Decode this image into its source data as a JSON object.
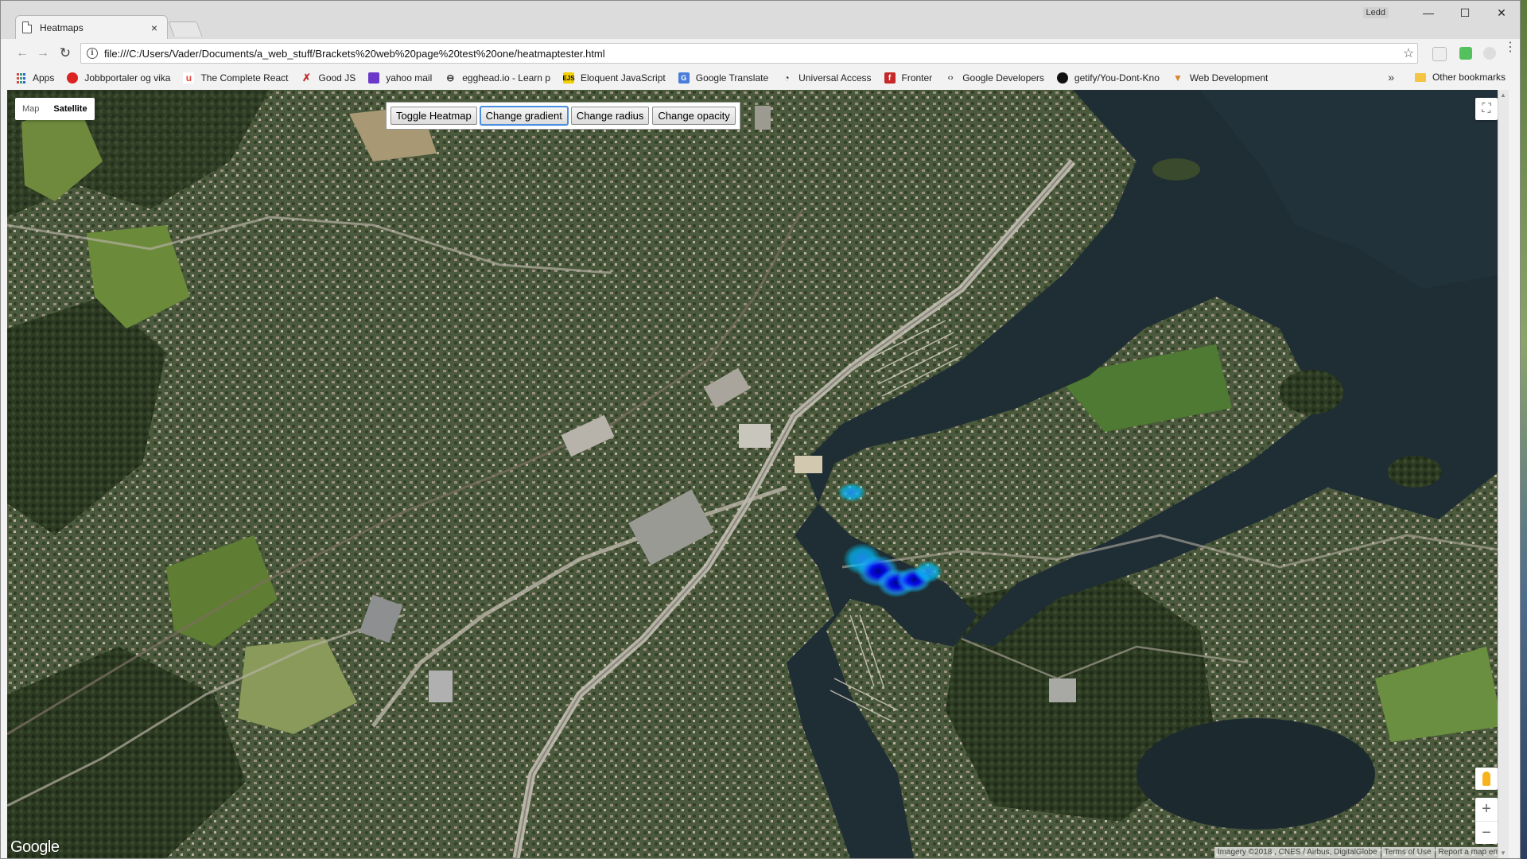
{
  "browser": {
    "tab_title": "Heatmaps",
    "tab_close": "×",
    "profile_name": "Ledd",
    "url": "file:///C:/Users/Vader/Documents/a_web_stuff/Brackets%20web%20page%20test%20one/heatmaptester.html",
    "window_controls": {
      "minimize": "—",
      "maximize": "☐",
      "close": "✕"
    },
    "nav": {
      "back": "←",
      "forward": "→",
      "reload": "↻"
    },
    "star": "☆",
    "menu": "⋮"
  },
  "bookmarks": {
    "items": [
      {
        "label": "Apps",
        "icon": "apps-grid-icon",
        "color": "#d44"
      },
      {
        "label": "Jobbportaler og vika",
        "icon": "jobb-icon",
        "color": "#d22"
      },
      {
        "label": "The Complete React",
        "icon": "udemy-icon",
        "color": "#e0463a"
      },
      {
        "label": "Good JS",
        "icon": "goodjs-icon",
        "color": "#c62828"
      },
      {
        "label": "yahoo mail",
        "icon": "mail-icon",
        "color": "#6b39c9"
      },
      {
        "label": "egghead.io - Learn p",
        "icon": "egghead-icon",
        "color": "#333"
      },
      {
        "label": "Eloquent JavaScript",
        "icon": "ejs-icon",
        "color": "#c9a300"
      },
      {
        "label": "Google Translate",
        "icon": "translate-icon",
        "color": "#4a7ddb"
      },
      {
        "label": "Universal Access",
        "icon": "access-icon",
        "color": "#333"
      },
      {
        "label": "Fronter",
        "icon": "fronter-icon",
        "color": "#c62828"
      },
      {
        "label": "Google Developers",
        "icon": "gdev-icon",
        "color": "#555"
      },
      {
        "label": "getify/You-Dont-Kno",
        "icon": "github-icon",
        "color": "#111"
      },
      {
        "label": "Web Development",
        "icon": "webdev-icon",
        "color": "#d9822b"
      }
    ],
    "overflow": "»",
    "other": "Other bookmarks"
  },
  "map": {
    "maptype": {
      "map": "Map",
      "satellite": "Satellite"
    },
    "controls": {
      "toggle_heatmap": "Toggle Heatmap",
      "change_gradient": "Change gradient",
      "change_radius": "Change radius",
      "change_opacity": "Change opacity"
    },
    "fullscreen": "⛶",
    "zoom_in": "+",
    "zoom_out": "−",
    "logo": "Google",
    "attribution": {
      "imagery": "Imagery ©2018 , CNES / Airbus, DigitalGlobe",
      "terms": "Terms of Use",
      "report": "Report a map error"
    },
    "heat_colors": [
      "#00e5ff",
      "#1e90ff",
      "#0000ff",
      "#00008b"
    ]
  }
}
